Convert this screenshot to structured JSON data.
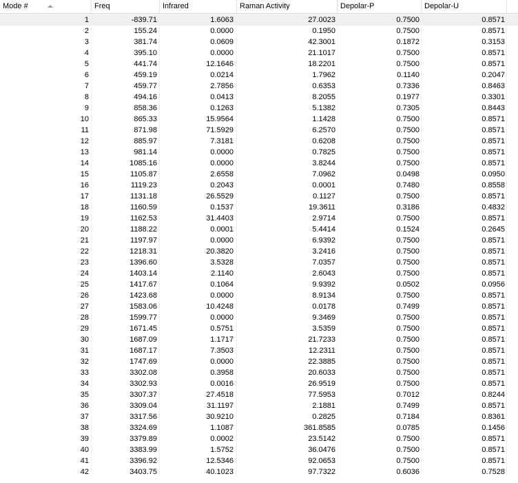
{
  "columns": [
    "Mode #",
    "Freq",
    "Infrared",
    "Raman Activity",
    "Depolar-P",
    "Depolar-U"
  ],
  "sort": {
    "column": "Mode #",
    "direction": "ascending"
  },
  "selected_row": 0,
  "rows": [
    [
      "1",
      "-839.71",
      "1.6063",
      "27.0023",
      "0.7500",
      "0.8571"
    ],
    [
      "2",
      "155.24",
      "0.0000",
      "0.1950",
      "0.7500",
      "0.8571"
    ],
    [
      "3",
      "381.74",
      "0.0609",
      "42.3001",
      "0.1872",
      "0.3153"
    ],
    [
      "4",
      "395.10",
      "0.0000",
      "21.1017",
      "0.7500",
      "0.8571"
    ],
    [
      "5",
      "441.74",
      "12.1646",
      "18.2201",
      "0.7500",
      "0.8571"
    ],
    [
      "6",
      "459.19",
      "0.0214",
      "1.7962",
      "0.1140",
      "0.2047"
    ],
    [
      "7",
      "459.77",
      "2.7856",
      "0.6353",
      "0.7336",
      "0.8463"
    ],
    [
      "8",
      "494.16",
      "0.0413",
      "8.2055",
      "0.1977",
      "0.3301"
    ],
    [
      "9",
      "858.36",
      "0.1263",
      "5.1382",
      "0.7305",
      "0.8443"
    ],
    [
      "10",
      "865.33",
      "15.9564",
      "1.1428",
      "0.7500",
      "0.8571"
    ],
    [
      "11",
      "871.98",
      "71.5929",
      "6.2570",
      "0.7500",
      "0.8571"
    ],
    [
      "12",
      "885.97",
      "7.3181",
      "0.6208",
      "0.7500",
      "0.8571"
    ],
    [
      "13",
      "981.14",
      "0.0000",
      "0.7825",
      "0.7500",
      "0.8571"
    ],
    [
      "14",
      "1085.16",
      "0.0000",
      "3.8244",
      "0.7500",
      "0.8571"
    ],
    [
      "15",
      "1105.87",
      "2.6558",
      "7.0962",
      "0.0498",
      "0.0950"
    ],
    [
      "16",
      "1119.23",
      "0.2043",
      "0.0001",
      "0.7480",
      "0.8558"
    ],
    [
      "17",
      "1131.18",
      "26.5529",
      "0.1127",
      "0.7500",
      "0.8571"
    ],
    [
      "18",
      "1160.59",
      "0.1537",
      "19.3611",
      "0.3186",
      "0.4832"
    ],
    [
      "19",
      "1162.53",
      "31.4403",
      "2.9714",
      "0.7500",
      "0.8571"
    ],
    [
      "20",
      "1188.22",
      "0.0001",
      "5.4414",
      "0.1524",
      "0.2645"
    ],
    [
      "21",
      "1197.97",
      "0.0000",
      "6.9392",
      "0.7500",
      "0.8571"
    ],
    [
      "22",
      "1218.31",
      "20.3820",
      "3.2416",
      "0.7500",
      "0.8571"
    ],
    [
      "23",
      "1396.60",
      "3.5328",
      "7.0357",
      "0.7500",
      "0.8571"
    ],
    [
      "24",
      "1403.14",
      "2.1140",
      "2.6043",
      "0.7500",
      "0.8571"
    ],
    [
      "25",
      "1417.67",
      "0.1064",
      "9.9392",
      "0.0502",
      "0.0956"
    ],
    [
      "26",
      "1423.68",
      "0.0000",
      "8.9134",
      "0.7500",
      "0.8571"
    ],
    [
      "27",
      "1583.06",
      "10.4248",
      "0.0178",
      "0.7499",
      "0.8571"
    ],
    [
      "28",
      "1599.77",
      "0.0000",
      "9.3469",
      "0.7500",
      "0.8571"
    ],
    [
      "29",
      "1671.45",
      "0.5751",
      "3.5359",
      "0.7500",
      "0.8571"
    ],
    [
      "30",
      "1687.09",
      "1.1717",
      "21.7233",
      "0.7500",
      "0.8571"
    ],
    [
      "31",
      "1687.17",
      "7.3503",
      "12.2311",
      "0.7500",
      "0.8571"
    ],
    [
      "32",
      "1747.69",
      "0.0000",
      "22.3885",
      "0.7500",
      "0.8571"
    ],
    [
      "33",
      "3302.08",
      "0.3958",
      "20.6033",
      "0.7500",
      "0.8571"
    ],
    [
      "34",
      "3302.93",
      "0.0016",
      "26.9519",
      "0.7500",
      "0.8571"
    ],
    [
      "35",
      "3307.37",
      "27.4518",
      "77.5953",
      "0.7012",
      "0.8244"
    ],
    [
      "36",
      "3309.04",
      "31.1197",
      "2.1881",
      "0.7499",
      "0.8571"
    ],
    [
      "37",
      "3317.56",
      "30.9210",
      "0.2825",
      "0.7184",
      "0.8361"
    ],
    [
      "38",
      "3324.69",
      "1.1087",
      "361.8585",
      "0.0785",
      "0.1456"
    ],
    [
      "39",
      "3379.89",
      "0.0002",
      "23.5142",
      "0.7500",
      "0.8571"
    ],
    [
      "40",
      "3383.99",
      "1.5752",
      "36.0476",
      "0.7500",
      "0.8571"
    ],
    [
      "41",
      "3396.92",
      "12.5346",
      "92.0653",
      "0.7500",
      "0.8571"
    ],
    [
      "42",
      "3403.75",
      "40.1023",
      "97.7322",
      "0.6036",
      "0.7528"
    ]
  ]
}
